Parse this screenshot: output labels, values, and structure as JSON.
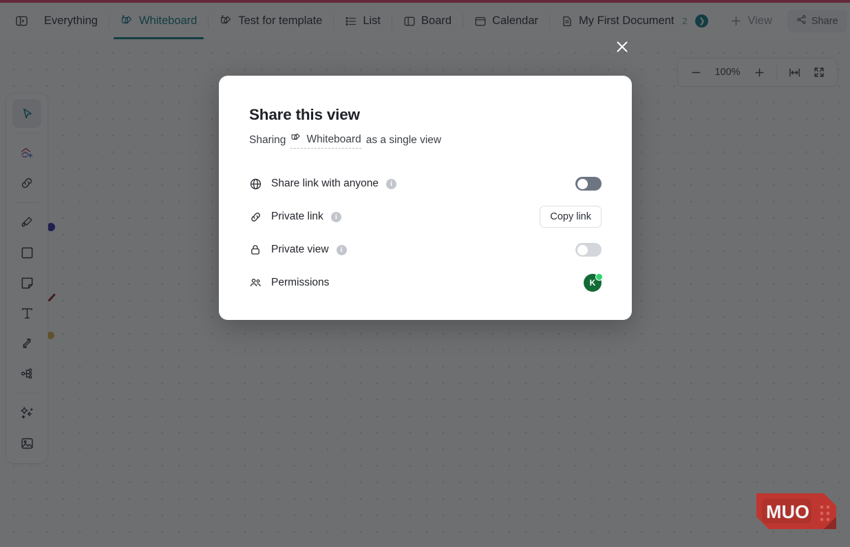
{
  "window": {
    "accent_color": "#e0456e"
  },
  "tabbar": {
    "panel_toggle_name": "sidebar-panel-toggle",
    "items": [
      {
        "label": "Everything",
        "icon": "panel-icon",
        "active": false
      },
      {
        "label": "Whiteboard",
        "icon": "whiteboard-icon",
        "active": true
      },
      {
        "label": "Test for template",
        "icon": "whiteboard-icon",
        "active": false
      },
      {
        "label": "List",
        "icon": "list-icon",
        "active": false
      },
      {
        "label": "Board",
        "icon": "board-icon",
        "active": false
      },
      {
        "label": "Calendar",
        "icon": "calendar-icon",
        "active": false
      },
      {
        "label": "My First Document",
        "icon": "document-icon",
        "active": false
      }
    ],
    "doc_badge_count": "2",
    "add_view_label": "View",
    "share_label": "Share"
  },
  "canvas": {
    "zoom": {
      "level": "100%",
      "zoom_out_label": "−",
      "zoom_in_label": "+",
      "fit_width_label": "|↔|",
      "fullscreen_label": "fullscreen"
    },
    "avatar_initial": "K",
    "info_label": "i"
  },
  "toolbar": {
    "tools": [
      {
        "name": "select-tool",
        "icon": "cursor-icon",
        "selected": true
      },
      {
        "name": "add-shape-tool",
        "icon": "shapes-plus-icon",
        "selected": false
      },
      {
        "name": "link-tool",
        "icon": "link-icon",
        "selected": false
      },
      {
        "name": "highlighter-tool",
        "icon": "highlighter-icon",
        "selected": false
      },
      {
        "name": "rectangle-tool",
        "icon": "square-icon",
        "selected": false
      },
      {
        "name": "sticky-note-tool",
        "icon": "sticky-note-icon",
        "selected": false
      },
      {
        "name": "text-tool",
        "icon": "text-icon",
        "selected": false
      },
      {
        "name": "connector-tool",
        "icon": "arrows-icon",
        "selected": false
      },
      {
        "name": "mindmap-tool",
        "icon": "mindmap-icon",
        "selected": false
      },
      {
        "name": "ai-tool",
        "icon": "magic-wand-icon",
        "selected": false
      },
      {
        "name": "image-tool",
        "icon": "image-icon",
        "selected": false
      }
    ]
  },
  "modal": {
    "close_label": "×",
    "title": "Share this view",
    "sharing_prefix": "Sharing",
    "view_name": "Whiteboard",
    "sharing_suffix": "as a single view",
    "rows": [
      {
        "icon": "globe-icon",
        "label": "Share link with anyone",
        "info": "i",
        "control": "toggle",
        "toggle_state": "off",
        "control_name": "share-link-toggle"
      },
      {
        "icon": "chain-link-icon",
        "label": "Private link",
        "info": "i",
        "control": "button",
        "button_label": "Copy link",
        "control_name": "copy-link-button"
      },
      {
        "icon": "lock-icon",
        "label": "Private view",
        "info": "i",
        "control": "toggle",
        "toggle_state": "muted",
        "control_name": "private-view-toggle"
      },
      {
        "icon": "people-icon",
        "label": "Permissions",
        "info": null,
        "control": "avatar",
        "avatar_initial": "K",
        "control_name": "permissions-avatar"
      }
    ]
  },
  "watermark": {
    "text": "MUO",
    "color": "#c6322b"
  }
}
